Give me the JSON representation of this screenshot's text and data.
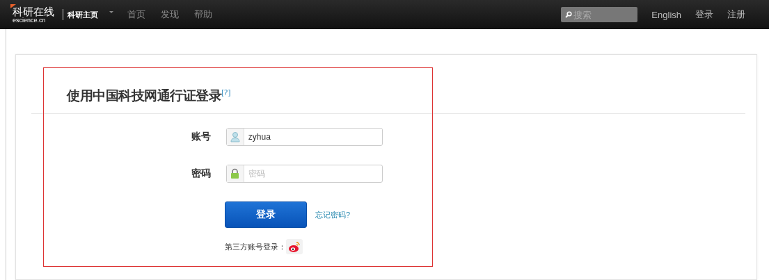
{
  "navbar": {
    "logo_title": "科研在线",
    "logo_domain": "escience.cn",
    "home_link": "科研主页",
    "links": [
      "首页",
      "发现",
      "帮助"
    ],
    "search": {
      "placeholder": "搜索"
    },
    "right_links": [
      "English",
      "登录",
      "注册"
    ]
  },
  "login": {
    "title": "使用中国科技网通行证登录",
    "help_mark": "[?]",
    "fields": [
      {
        "label": "账号",
        "kind": "user",
        "value": "zyhua"
      },
      {
        "label": "密码",
        "kind": "password",
        "placeholder": "密码"
      }
    ],
    "submit": "登录",
    "forgot": "忘记密码?",
    "third_party": "第三方账号登录："
  }
}
